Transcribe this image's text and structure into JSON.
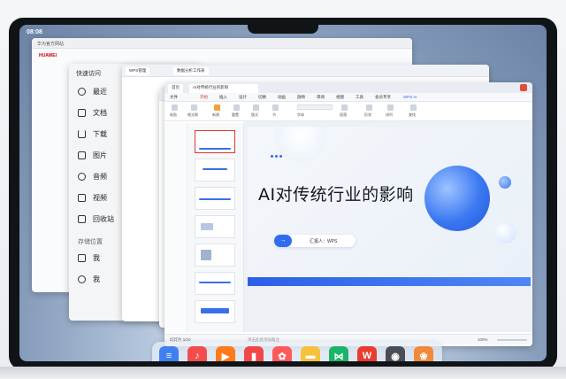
{
  "status_bar": {
    "time": "08:08"
  },
  "browser": {
    "tab_label": "华为官方网站",
    "brand": "HUAWEI"
  },
  "files": {
    "header": "快速访问",
    "items": [
      {
        "label": "最近",
        "icon": "clock-icon"
      },
      {
        "label": "文档",
        "icon": "document-icon"
      },
      {
        "label": "下载",
        "icon": "download-icon"
      },
      {
        "label": "图片",
        "icon": "image-icon"
      },
      {
        "label": "音频",
        "icon": "music-icon"
      },
      {
        "label": "视频",
        "icon": "video-icon"
      },
      {
        "label": "回收站",
        "icon": "trash-icon"
      }
    ],
    "storage_header": "存储位置",
    "storage_items": [
      {
        "label": "我",
        "icon": "laptop-icon"
      },
      {
        "label": "我",
        "icon": "cloud-icon"
      }
    ]
  },
  "wps_back": {
    "tab_label": "WPS管理",
    "tab2_label": "数据分析工作表"
  },
  "wps_main": {
    "tabs": [
      "首页",
      "AI对传统行业的影响"
    ],
    "menus": [
      "文件",
      "开始",
      "插入",
      "设计",
      "切换",
      "动画",
      "放映",
      "审阅",
      "视图",
      "工具",
      "会员专享",
      "WPS AI"
    ],
    "ribbon": [
      "粘贴",
      "格式刷",
      "新建",
      "重置",
      "版式",
      "节",
      "字体",
      "段落",
      "形状",
      "排列",
      "查找"
    ],
    "slide_count": 7,
    "slide": {
      "title": "AI对传统行业的影响",
      "presenter": "汇报人：WPS"
    },
    "notes": "单击此处添加备注",
    "status": {
      "page": "幻灯片 1/10",
      "zoom": "100%"
    }
  },
  "dock": {
    "apps": [
      {
        "name": "notes",
        "icon": "notes-app-icon",
        "color": "#3f7ff0",
        "glyph": "≡"
      },
      {
        "name": "music",
        "icon": "music-app-icon",
        "color": "#f24c4c",
        "glyph": "♪"
      },
      {
        "name": "video",
        "icon": "video-app-icon",
        "color": "#ff7a1a",
        "glyph": "▶"
      },
      {
        "name": "books",
        "icon": "books-app-icon",
        "color": "#f04848",
        "glyph": "▮"
      },
      {
        "name": "lotus",
        "icon": "lotus-app-icon",
        "color": "#ff5a5a",
        "glyph": "✿"
      },
      {
        "name": "files",
        "icon": "folder-app-icon",
        "color": "#f5c23a",
        "glyph": "▬"
      },
      {
        "name": "wps-spreadsheet",
        "icon": "spreadsheet-app-icon",
        "color": "#1bb46a",
        "glyph": "⋈"
      },
      {
        "name": "wps",
        "icon": "wps-app-icon",
        "color": "#e93b2e",
        "glyph": "W"
      },
      {
        "name": "camera",
        "icon": "camera-app-icon",
        "color": "#4a4d55",
        "glyph": "◉"
      },
      {
        "name": "gallery",
        "icon": "gallery-app-icon",
        "color": "#f08a3a",
        "glyph": "❀"
      }
    ]
  }
}
